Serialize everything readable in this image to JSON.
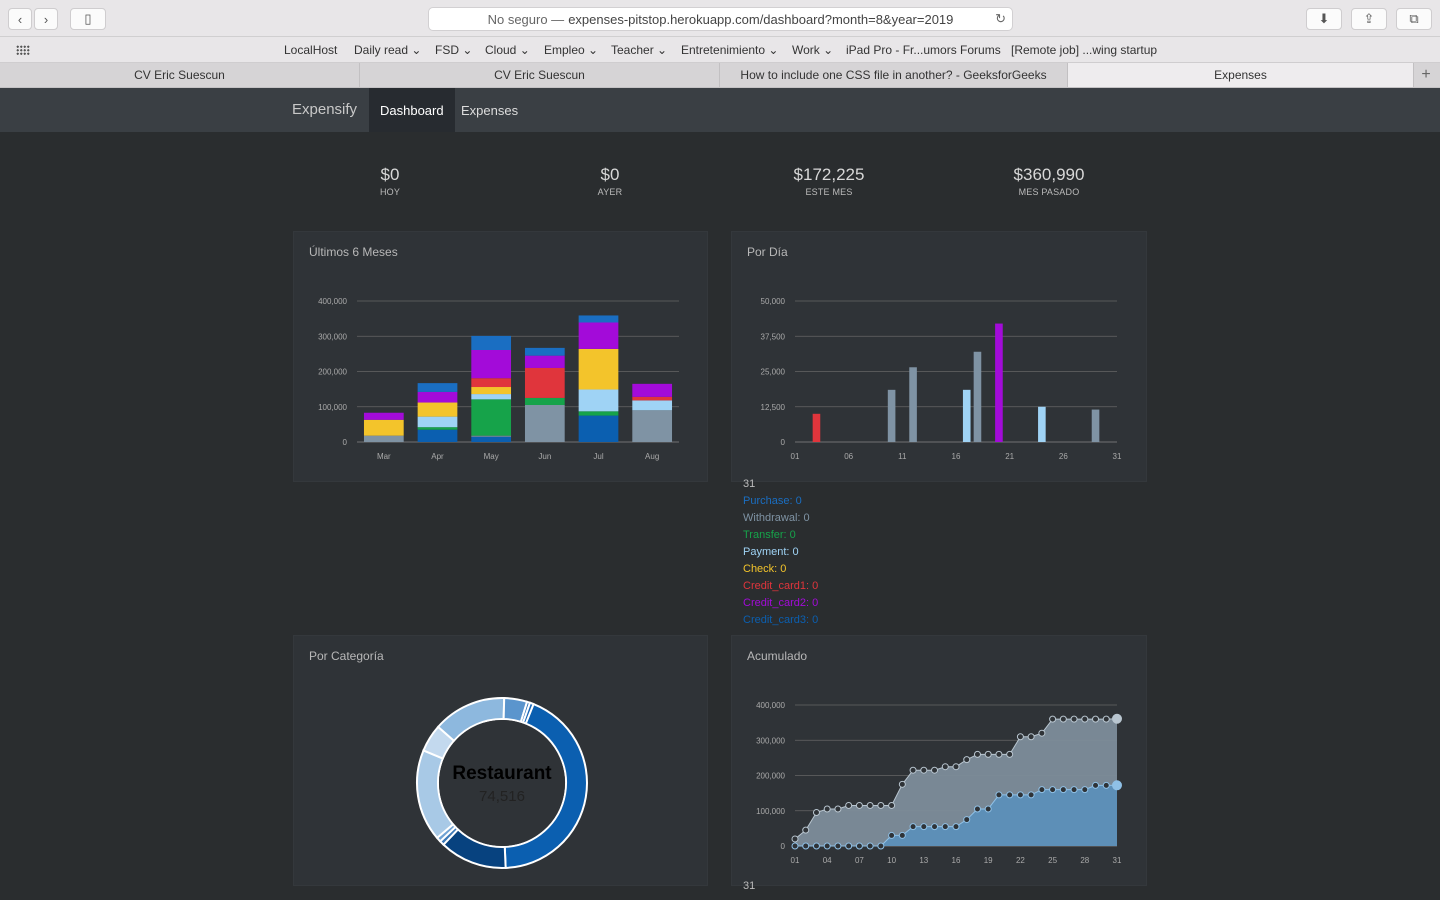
{
  "browser": {
    "address_prefix": "No seguro —",
    "address_url": "expenses-pitstop.herokuapp.com/dashboard?month=8&year=2019",
    "bookmarks": [
      "LocalHost",
      "Daily read",
      "FSD",
      "Cloud",
      "Empleo",
      "Teacher",
      "Entretenimiento",
      "Work",
      "iPad Pro - Fr...umors Forums",
      "[Remote job] ...wing startup"
    ],
    "tabs": [
      "CV Eric Suescun",
      "CV Eric Suescun",
      "How to include one CSS file in another? - GeeksforGeeks",
      "Expenses"
    ],
    "active_tab": 3
  },
  "nav": {
    "brand": "Expensify",
    "items": [
      "Dashboard",
      "Expenses"
    ],
    "active": 0
  },
  "stats": [
    {
      "value": "$0",
      "label": "HOY"
    },
    {
      "value": "$0",
      "label": "AYER"
    },
    {
      "value": "$172,225",
      "label": "ESTE MES"
    },
    {
      "value": "$360,990",
      "label": "MES PASADO"
    }
  ],
  "colors": {
    "Purchase": "#1a6ec2",
    "Withdrawal": "#7f93a4",
    "Transfer": "#16a34a",
    "Payment": "#9fd3f5",
    "Check": "#f3c42b",
    "Credit_card1": "#e0353c",
    "Credit_card2": "#a30bd9",
    "Credit_card3": "#0b5fb0"
  },
  "panels": {
    "months_title": "Últimos 6 Meses",
    "daily_title": "Por Día",
    "category_title": "Por Categoría",
    "cumulative_title": "Acumulado"
  },
  "chart_data": [
    {
      "type": "bar",
      "title": "Últimos 6 Meses",
      "stacked": true,
      "categories": [
        "Mar",
        "Apr",
        "May",
        "Jun",
        "Jul",
        "Aug"
      ],
      "yticks": [
        "0",
        "100,000",
        "200,000",
        "300,000",
        "400,000"
      ],
      "ylim": [
        0,
        400000
      ],
      "series": [
        {
          "name": "Credit_card3",
          "values": [
            0,
            35000,
            15000,
            0,
            75000,
            0
          ]
        },
        {
          "name": "Withdrawal",
          "values": [
            18000,
            0,
            3000,
            105000,
            0,
            90000
          ]
        },
        {
          "name": "Transfer",
          "values": [
            0,
            7000,
            103000,
            20000,
            12000,
            0
          ]
        },
        {
          "name": "Payment",
          "values": [
            0,
            30000,
            15000,
            0,
            62000,
            28000
          ]
        },
        {
          "name": "Check",
          "values": [
            45000,
            40000,
            20000,
            0,
            115000,
            0
          ]
        },
        {
          "name": "Credit_card1",
          "values": [
            0,
            0,
            25000,
            85000,
            0,
            10000
          ]
        },
        {
          "name": "Credit_card2",
          "values": [
            20000,
            30000,
            80000,
            35000,
            75000,
            37000
          ]
        },
        {
          "name": "Purchase",
          "values": [
            0,
            25000,
            40000,
            22000,
            20000,
            0
          ]
        }
      ]
    },
    {
      "type": "bar",
      "title": "Por Día",
      "xticks": [
        "01",
        "06",
        "11",
        "16",
        "21",
        "26",
        "31"
      ],
      "yticks": [
        "0",
        "12,500",
        "25,000",
        "37,500",
        "50,000"
      ],
      "ylim": [
        0,
        50000
      ],
      "xlim": [
        1,
        31
      ],
      "bars": [
        {
          "day": 3,
          "value": 10000,
          "type": "Credit_card1"
        },
        {
          "day": 10,
          "value": 18500,
          "type": "Withdrawal"
        },
        {
          "day": 12,
          "value": 26500,
          "type": "Withdrawal"
        },
        {
          "day": 17,
          "value": 18500,
          "type": "Payment"
        },
        {
          "day": 18,
          "value": 32000,
          "type": "Withdrawal"
        },
        {
          "day": 20,
          "value": 42000,
          "type": "Credit_card2"
        },
        {
          "day": 24,
          "value": 12500,
          "type": "Payment"
        },
        {
          "day": 29,
          "value": 11500,
          "type": "Withdrawal"
        }
      ]
    },
    {
      "type": "pie",
      "title": "Por Categoría",
      "center_label": "Restaurant",
      "center_value": "74,516",
      "slices": [
        {
          "value": 74516,
          "color": "#0b5fb0"
        },
        {
          "value": 22000,
          "color": "#07427f"
        },
        {
          "value": 1500,
          "color": "#3c79b8"
        },
        {
          "value": 1500,
          "color": "#6fa2d3"
        },
        {
          "value": 30000,
          "color": "#a8c9e6"
        },
        {
          "value": 9000,
          "color": "#c3d9ee"
        },
        {
          "value": 24000,
          "color": "#8db8de"
        },
        {
          "value": 7500,
          "color": "#5b95cd"
        },
        {
          "value": 1000,
          "color": "#2f73b8"
        },
        {
          "value": 1209,
          "color": "#1966b6"
        }
      ]
    },
    {
      "type": "area",
      "title": "Acumulado",
      "xticks": [
        "01",
        "04",
        "07",
        "10",
        "13",
        "16",
        "19",
        "22",
        "25",
        "28",
        "31"
      ],
      "yticks": [
        "0",
        "100,000",
        "200,000",
        "300,000",
        "400,000"
      ],
      "ylim": [
        0,
        400000
      ],
      "x": [
        1,
        2,
        3,
        4,
        5,
        6,
        7,
        8,
        9,
        10,
        11,
        12,
        13,
        14,
        15,
        16,
        17,
        18,
        19,
        20,
        21,
        22,
        23,
        24,
        25,
        26,
        27,
        28,
        29,
        30,
        31
      ],
      "series": [
        {
          "name": "Mes pasado",
          "values": [
            20000,
            45000,
            95000,
            105000,
            105000,
            115000,
            115000,
            115000,
            115000,
            115000,
            175000,
            215000,
            215000,
            215000,
            225000,
            225000,
            245000,
            260000,
            260000,
            260000,
            260000,
            310000,
            310000,
            320000,
            360000,
            360000,
            360000,
            360000,
            360000,
            360000,
            360990
          ]
        },
        {
          "name": "Este mes",
          "values": [
            0,
            0,
            0,
            0,
            0,
            0,
            0,
            0,
            0,
            30000,
            30000,
            55000,
            55000,
            55000,
            55000,
            55000,
            75000,
            105000,
            105000,
            145000,
            145000,
            145000,
            145000,
            160000,
            160000,
            160000,
            160000,
            160000,
            172000,
            172000,
            172225
          ]
        }
      ]
    }
  ],
  "legend": {
    "day": "31",
    "items": [
      {
        "text": "Purchase: 0",
        "key": "Purchase"
      },
      {
        "text": "Withdrawal: 0",
        "key": "Withdrawal"
      },
      {
        "text": "Transfer: 0",
        "key": "Transfer"
      },
      {
        "text": "Payment: 0",
        "key": "Payment"
      },
      {
        "text": "Check: 0",
        "key": "Check"
      },
      {
        "text": "Credit_card1: 0",
        "key": "Credit_card1"
      },
      {
        "text": "Credit_card2: 0",
        "key": "Credit_card2"
      },
      {
        "text": "Credit_card3: 0",
        "key": "Credit_card3"
      }
    ],
    "day2": "31"
  }
}
